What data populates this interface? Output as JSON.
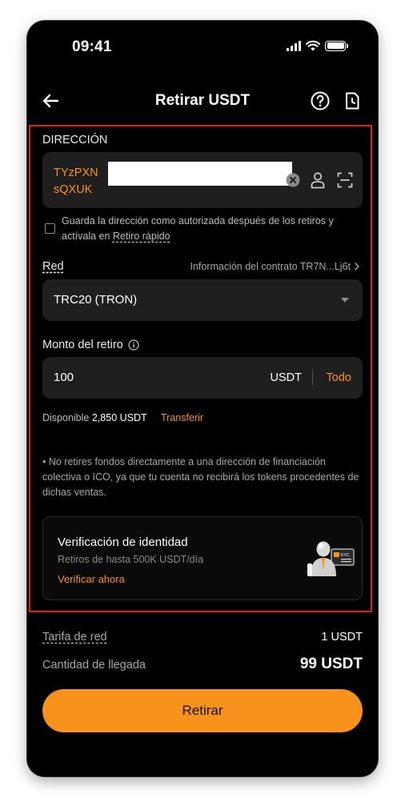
{
  "status_bar": {
    "time": "09:41"
  },
  "header": {
    "title": "Retirar USDT"
  },
  "address": {
    "label": "DIRECCIÓN",
    "line1": "TYzPXN",
    "line2": "sQXUK",
    "save_text": "Guarda la dirección como autorizada después de los retiros y actívala en ",
    "save_link": "Retiro rápido"
  },
  "network": {
    "label": "Red",
    "contract_info": "Información del contrato TR7N...Lj6t",
    "value": "TRC20 (TRON)"
  },
  "amount": {
    "label": "Monto del retiro",
    "value": "100",
    "unit": "USDT",
    "all_label": "Todo",
    "available_label": "Disponible",
    "available_value": "2,850 USDT",
    "transfer_label": "Transferir"
  },
  "notice": "• No retires fondos directamente a una dirección de financiación colectiva o ICO, ya que tu cuenta no recibirá los tokens procedentes de dichas ventas.",
  "verification": {
    "title": "Verificación de identidad",
    "subtitle": "Retiros de hasta 500K USDT/día",
    "link": "Verificar ahora",
    "badge": "KYC"
  },
  "summary": {
    "fee_label": "Tarifa de red",
    "fee_value": "1 USDT",
    "arrival_label": "Cantidad de llegada",
    "arrival_value": "99 USDT"
  },
  "submit_label": "Retirar",
  "colors": {
    "accent": "#f7931a",
    "background": "#000000",
    "surface": "#1f1f1f",
    "highlight_border": "#e0201a"
  }
}
